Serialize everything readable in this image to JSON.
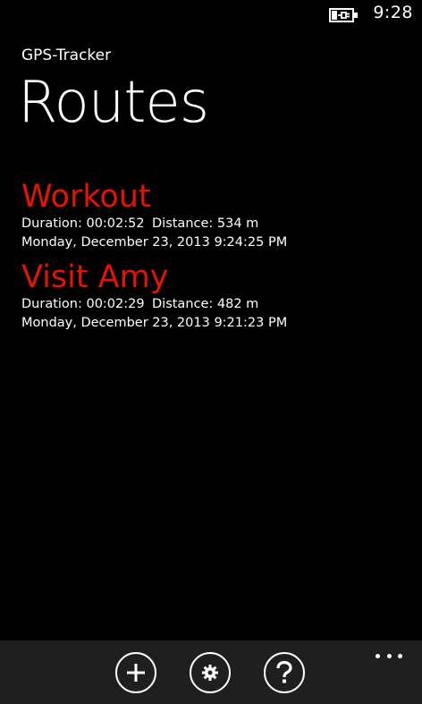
{
  "status_bar": {
    "time": "9:28",
    "battery_icon": "battery-charging-icon"
  },
  "app": {
    "title": "GPS-Tracker"
  },
  "page": {
    "title": "Routes"
  },
  "routes": [
    {
      "name": "Workout",
      "duration": "Duration: 00:02:52",
      "distance": "Distance: 534 m",
      "date": "Monday, December 23, 2013 9:24:25 PM"
    },
    {
      "name": "Visit Amy",
      "duration": "Duration: 00:02:29",
      "distance": "Distance: 482 m",
      "date": "Monday, December 23, 2013 9:21:23 PM"
    }
  ],
  "app_bar": {
    "buttons": [
      {
        "icon": "add-icon"
      },
      {
        "icon": "settings-icon"
      },
      {
        "icon": "help-icon"
      }
    ],
    "more_icon": "ellipsis-icon"
  },
  "colors": {
    "accent": "#e51400",
    "background": "#000000",
    "app_bar": "#1f1f1f",
    "text": "#ffffff"
  }
}
